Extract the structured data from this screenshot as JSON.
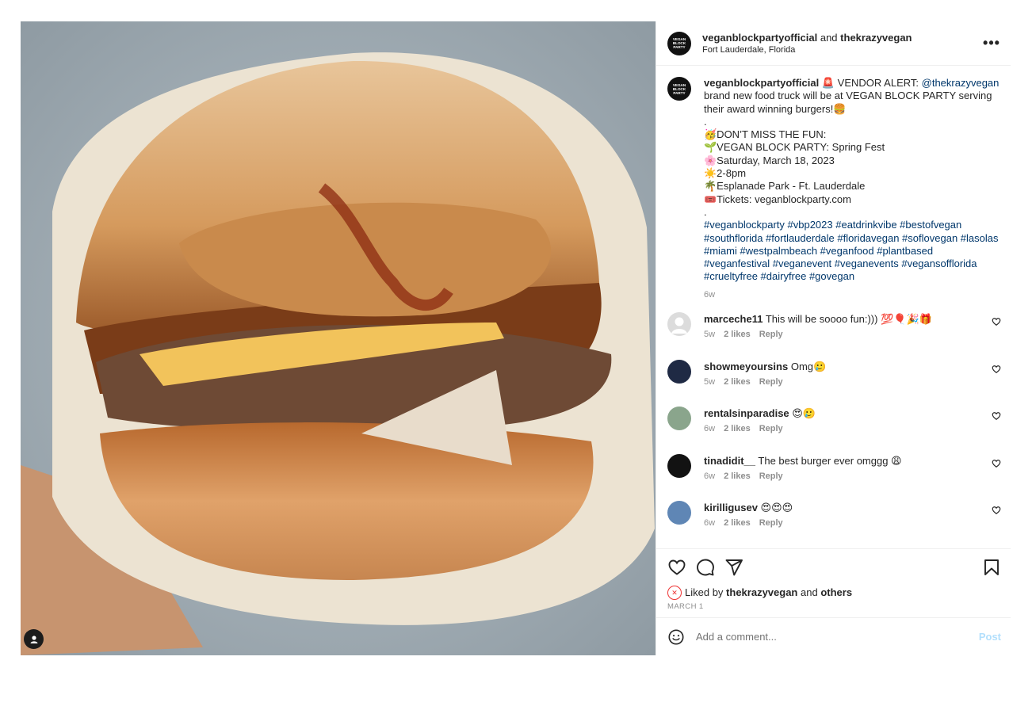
{
  "header": {
    "author": "veganblockpartyofficial",
    "joiner": "and",
    "coauthor": "thekrazyvegan",
    "location": "Fort Lauderdale, Florida",
    "more_label": "•••",
    "avatar_text": "VEGAN BLOCK PARTY"
  },
  "caption": {
    "author": "veganblockpartyofficial",
    "line1_emoji": "🚨",
    "line1_text": "VENDOR ALERT:",
    "mention": "@thekrazyvegan",
    "line1_rest": "brand new food truck will be at VEGAN BLOCK PARTY serving their award winning burgers!🍔",
    "dot1": ".",
    "fun": "🥳DON’T MISS THE FUN:",
    "event": "🌱VEGAN BLOCK PARTY: Spring Fest",
    "date": "🌸Saturday, March 18, 2023",
    "hours": "☀️2-8pm",
    "place": "🌴Esplanade Park - Ft. Lauderdale",
    "tickets": "🎟️Tickets: veganblockparty.com",
    "dot2": ".",
    "hashtags": "#veganblockparty #vbp2023 #eatdrinkvibe #bestofvegan #southflorida #fortlauderdale #floridavegan #soflovegan #lasolas #miami #westpalmbeach #veganfood #plantbased #veganfestival #veganevent #veganevents #vegansofflorida #crueltyfree #dairyfree #govegan",
    "time": "6w"
  },
  "comments": [
    {
      "user": "marceche11",
      "text": "This will be soooo fun:))) 💯🎈🎉🎁",
      "time": "5w",
      "likes": "2 likes",
      "reply": "Reply",
      "avatar_color": "#dcdcdc",
      "avatar_icon": "default-avatar-icon"
    },
    {
      "user": "showmeyoursins",
      "text": "Omg🥲",
      "time": "5w",
      "likes": "2 likes",
      "reply": "Reply",
      "avatar_color": "#1f2a44",
      "avatar_icon": "photo-avatar"
    },
    {
      "user": "rentalsinparadise",
      "text": "😍🥲",
      "time": "6w",
      "likes": "2 likes",
      "reply": "Reply",
      "avatar_color": "#8aa58c",
      "avatar_icon": "photo-avatar"
    },
    {
      "user": "tinadidit__",
      "text": "The best burger ever omggg 😩",
      "time": "6w",
      "likes": "2 likes",
      "reply": "Reply",
      "avatar_color": "#121212",
      "avatar_icon": "photo-avatar"
    },
    {
      "user": "kirilligusev",
      "text": "😍😍😍",
      "time": "6w",
      "likes": "2 likes",
      "reply": "Reply",
      "avatar_color": "#5f86b5",
      "avatar_icon": "photo-avatar"
    }
  ],
  "likes": {
    "prefix": "Liked by",
    "user": "thekrazyvegan",
    "joiner": "and",
    "others": "others",
    "date": "MARCH 1"
  },
  "add_comment": {
    "placeholder": "Add a comment...",
    "post_label": "Post"
  },
  "icons": {
    "like": "heart-icon",
    "comment": "comment-bubble-icon",
    "share": "paper-plane-icon",
    "save": "bookmark-icon",
    "emoji": "smiley-icon",
    "tag": "user-tag-icon"
  },
  "colors": {
    "link": "#00376b",
    "muted": "#8e8e8e",
    "post_button": "#b2dffc",
    "divider": "#efefef"
  }
}
